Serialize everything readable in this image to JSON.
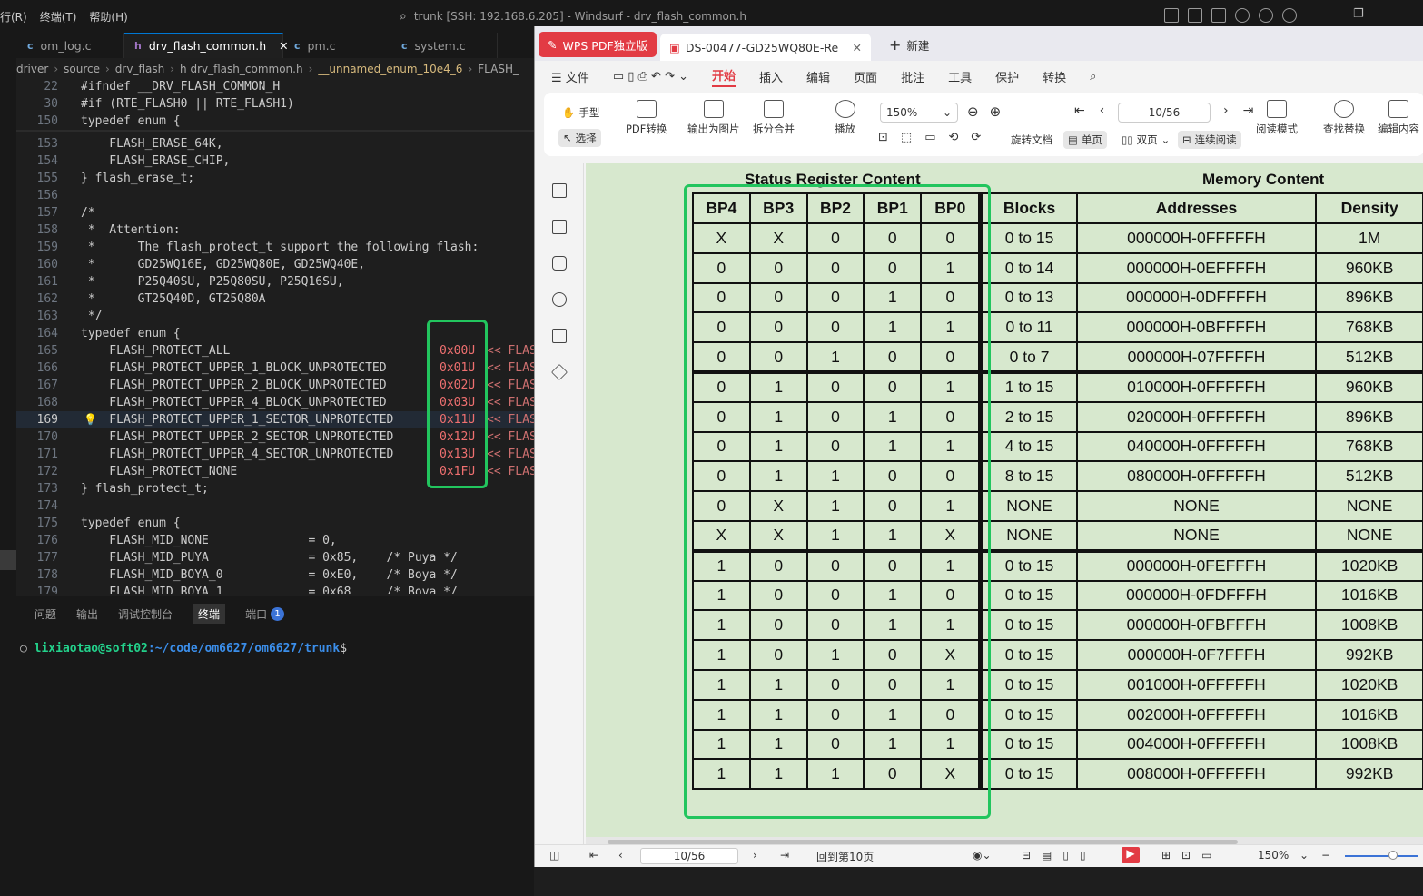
{
  "ide": {
    "menu": [
      "行(R)",
      "终端(T)",
      "帮助(H)"
    ],
    "window_title": "trunk [SSH: 192.168.6.205] - Windsurf - drv_flash_common.h",
    "tabs": [
      {
        "icon": "c",
        "label": "om_log.c"
      },
      {
        "icon": "h",
        "label": "drv_flash_common.h",
        "close": "✕"
      },
      {
        "icon": "c",
        "label": "pm.c"
      },
      {
        "icon": "c",
        "label": "system.c"
      }
    ],
    "breadcrumbs": [
      "driver",
      "source",
      "drv_flash",
      "h  drv_flash_common.h",
      "__unnamed_enum_10e4_6",
      "FLASH_"
    ],
    "code_lines": [
      {
        "n": "22",
        "t": "#ifndef __DRV_FLASH_COMMON_H",
        "k": "mac"
      },
      {
        "n": "30",
        "t": "#if (RTE_FLASH0 || RTE_FLASH1)",
        "k": "mac"
      },
      {
        "n": "150",
        "t": "typedef enum {",
        "k": "kw"
      },
      {
        "n": "153",
        "t": "    FLASH_ERASE_64K,",
        "k": ""
      },
      {
        "n": "154",
        "t": "    FLASH_ERASE_CHIP,",
        "k": ""
      },
      {
        "n": "155",
        "t": "} flash_erase_t;",
        "k": ""
      },
      {
        "n": "156",
        "t": "",
        "k": ""
      },
      {
        "n": "157",
        "t": "/*",
        "k": "cm"
      },
      {
        "n": "158",
        "t": " *  Attention:",
        "k": "cm"
      },
      {
        "n": "159",
        "t": " *      The flash_protect_t support the following flash:",
        "k": "cm"
      },
      {
        "n": "160",
        "t": " *      GD25WQ16E, GD25WQ80E, GD25WQ40E,",
        "k": "cm"
      },
      {
        "n": "161",
        "t": " *      P25Q40SU, P25Q80SU, P25Q16SU,",
        "k": "cm"
      },
      {
        "n": "162",
        "t": " *      GT25Q40D, GT25Q80A",
        "k": "cm"
      },
      {
        "n": "163",
        "t": " */",
        "k": "cm"
      },
      {
        "n": "164",
        "t": "typedef enum {",
        "k": "kw"
      },
      {
        "n": "165",
        "t": "    FLASH_PROTECT_ALL",
        "k": "",
        "hex": "0x00U"
      },
      {
        "n": "166",
        "t": "    FLASH_PROTECT_UPPER_1_BLOCK_UNPROTECTED",
        "k": "",
        "hex": "0x01U"
      },
      {
        "n": "167",
        "t": "    FLASH_PROTECT_UPPER_2_BLOCK_UNPROTECTED",
        "k": "",
        "hex": "0x02U"
      },
      {
        "n": "168",
        "t": "    FLASH_PROTECT_UPPER_4_BLOCK_UNPROTECTED",
        "k": "",
        "hex": "0x03U"
      },
      {
        "n": "169",
        "t": "    FLASH_PROTECT_UPPER_1_SECTOR_UNPROTECTED",
        "k": "",
        "hex": "0x11U",
        "current": true
      },
      {
        "n": "170",
        "t": "    FLASH_PROTECT_UPPER_2_SECTOR_UNPROTECTED",
        "k": "",
        "hex": "0x12U"
      },
      {
        "n": "171",
        "t": "    FLASH_PROTECT_UPPER_4_SECTOR_UNPROTECTED",
        "k": "",
        "hex": "0x13U"
      },
      {
        "n": "172",
        "t": "    FLASH_PROTECT_NONE",
        "k": "",
        "hex": "0x1FU"
      },
      {
        "n": "173",
        "t": "} flash_protect_t;",
        "k": ""
      },
      {
        "n": "174",
        "t": "",
        "k": ""
      },
      {
        "n": "175",
        "t": "typedef enum {",
        "k": "kw"
      },
      {
        "n": "176",
        "t": "    FLASH_MID_NONE              = 0,",
        "k": ""
      },
      {
        "n": "177",
        "t": "    FLASH_MID_PUYA              = 0x85,    /* Puya */",
        "k": ""
      },
      {
        "n": "178",
        "t": "    FLASH_MID_BOYA_0            = 0xE0,    /* Boya */",
        "k": ""
      },
      {
        "n": "179",
        "t": "    FLASH_MID_BOYA_1            = 0x68,    /* Boya */",
        "k": ""
      }
    ],
    "shift_text": "<< FLAS",
    "panel_tabs": [
      "问题",
      "输出",
      "调试控制台",
      "终端",
      "端口"
    ],
    "ports_badge": "1",
    "terminal": {
      "user": "lixiaotao@soft02",
      "path": ":~/code/om6627/om6627/trunk",
      "suffix": "$"
    }
  },
  "wps": {
    "brand": "WPS PDF独立版",
    "doc_tab": "DS-00477-GD25WQ80E-Re",
    "new_tab": "新建",
    "menus": [
      "文件",
      "开始",
      "插入",
      "编辑",
      "页面",
      "批注",
      "工具",
      "保护",
      "转换"
    ],
    "tools": {
      "hand": "手型",
      "select": "选择",
      "pdf_convert": "PDF转换",
      "export_img": "输出为图片",
      "split_merge": "拆分合并",
      "play": "播放",
      "zoom": "150%",
      "page": "10/56",
      "rotate": "旋转文档",
      "single": "单页",
      "double": "双页",
      "continuous": "连续阅读",
      "read_mode": "阅读模式",
      "find": "查找替换",
      "edit": "编辑内容"
    },
    "status": {
      "page": "10/56",
      "back": "回到第10页",
      "zoom": "150%"
    },
    "table": {
      "group1": "Status Register Content",
      "group2": "Memory Content",
      "headers": [
        "BP4",
        "BP3",
        "BP2",
        "BP1",
        "BP0",
        "Blocks",
        "Addresses",
        "Density"
      ],
      "rows": [
        [
          "X",
          "X",
          "0",
          "0",
          "0",
          "0 to 15",
          "000000H-0FFFFFH",
          "1M"
        ],
        [
          "0",
          "0",
          "0",
          "0",
          "1",
          "0 to 14",
          "000000H-0EFFFFH",
          "960KB"
        ],
        [
          "0",
          "0",
          "0",
          "1",
          "0",
          "0 to 13",
          "000000H-0DFFFFH",
          "896KB"
        ],
        [
          "0",
          "0",
          "0",
          "1",
          "1",
          "0 to 11",
          "000000H-0BFFFFH",
          "768KB"
        ],
        [
          "0",
          "0",
          "1",
          "0",
          "0",
          "0 to 7",
          "000000H-07FFFFH",
          "512KB"
        ],
        [
          "0",
          "1",
          "0",
          "0",
          "1",
          "1 to 15",
          "010000H-0FFFFFH",
          "960KB"
        ],
        [
          "0",
          "1",
          "0",
          "1",
          "0",
          "2 to 15",
          "020000H-0FFFFFH",
          "896KB"
        ],
        [
          "0",
          "1",
          "0",
          "1",
          "1",
          "4 to 15",
          "040000H-0FFFFFH",
          "768KB"
        ],
        [
          "0",
          "1",
          "1",
          "0",
          "0",
          "8 to 15",
          "080000H-0FFFFFH",
          "512KB"
        ],
        [
          "0",
          "X",
          "1",
          "0",
          "1",
          "NONE",
          "NONE",
          "NONE"
        ],
        [
          "X",
          "X",
          "1",
          "1",
          "X",
          "NONE",
          "NONE",
          "NONE"
        ],
        [
          "1",
          "0",
          "0",
          "0",
          "1",
          "0 to 15",
          "000000H-0FEFFFH",
          "1020KB"
        ],
        [
          "1",
          "0",
          "0",
          "1",
          "0",
          "0 to 15",
          "000000H-0FDFFFH",
          "1016KB"
        ],
        [
          "1",
          "0",
          "0",
          "1",
          "1",
          "0 to 15",
          "000000H-0FBFFFH",
          "1008KB"
        ],
        [
          "1",
          "0",
          "1",
          "0",
          "X",
          "0 to 15",
          "000000H-0F7FFFH",
          "992KB"
        ],
        [
          "1",
          "1",
          "0",
          "0",
          "1",
          "0 to 15",
          "001000H-0FFFFFH",
          "1020KB"
        ],
        [
          "1",
          "1",
          "0",
          "1",
          "0",
          "0 to 15",
          "002000H-0FFFFFH",
          "1016KB"
        ],
        [
          "1",
          "1",
          "0",
          "1",
          "1",
          "0 to 15",
          "004000H-0FFFFFH",
          "1008KB"
        ],
        [
          "1",
          "1",
          "1",
          "0",
          "X",
          "0 to 15",
          "008000H-0FFFFFH",
          "992KB"
        ]
      ]
    }
  }
}
